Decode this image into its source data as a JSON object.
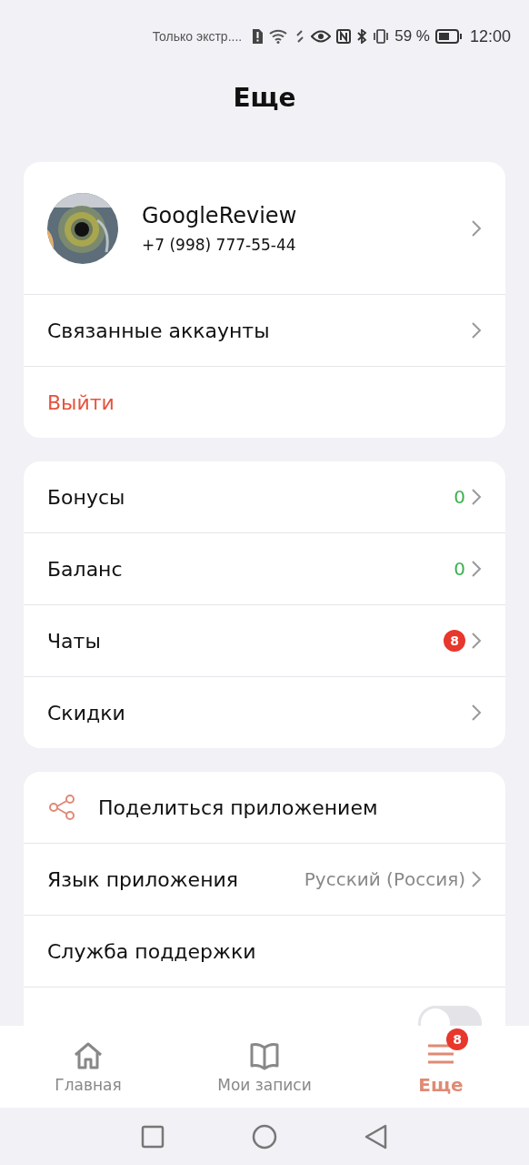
{
  "status_bar": {
    "carrier": "Только экстр....",
    "battery": "59 %",
    "time": "12:00"
  },
  "title": "Еще",
  "profile": {
    "name": "GoogleReview",
    "phone": "+7 (998) 777-55-44"
  },
  "account_items": [
    {
      "kind": "link",
      "label": "Связанные аккаунты"
    },
    {
      "kind": "danger",
      "label": "Выйти"
    }
  ],
  "menu_items": [
    {
      "kind": "value",
      "label": "Бонусы",
      "value": "0"
    },
    {
      "kind": "value",
      "label": "Баланс",
      "value": "0"
    },
    {
      "kind": "badge",
      "label": "Чаты",
      "value": "8"
    },
    {
      "kind": "link",
      "label": "Скидки"
    }
  ],
  "settings_items": [
    {
      "kind": "share",
      "label": "Поделиться приложением"
    },
    {
      "kind": "value_grey",
      "label": "Язык приложения",
      "value": "Русский (Россия)"
    },
    {
      "kind": "plain",
      "label": "Служба поддержки"
    },
    {
      "kind": "toggle",
      "on": false
    }
  ],
  "tabs": [
    {
      "kind": "home",
      "label": "Главная",
      "selected": false
    },
    {
      "kind": "book",
      "label": "Мои записи",
      "selected": false
    },
    {
      "kind": "menu",
      "label": "Еще",
      "selected": true,
      "badge": "8"
    }
  ]
}
